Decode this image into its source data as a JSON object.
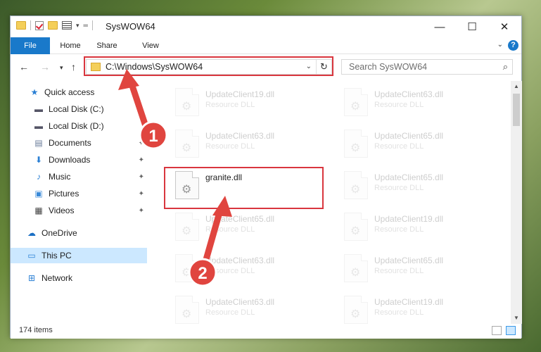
{
  "window": {
    "title": "SysWOW64",
    "controls": {
      "minimize": "—",
      "maximize": "☐",
      "close": "✕"
    }
  },
  "ribbon": {
    "tabs": [
      "File",
      "Home",
      "Share",
      "View"
    ],
    "help": "?"
  },
  "navigation": {
    "address": "C:\\Windows\\SysWOW64",
    "search_placeholder": "Search SysWOW64"
  },
  "sidebar": {
    "items": [
      {
        "label": "Quick access",
        "icon": "star-icon"
      },
      {
        "label": "Local Disk (C:)",
        "icon": "drive-icon",
        "pinned": true
      },
      {
        "label": "Local Disk (D:)",
        "icon": "drive-icon",
        "pinned": true
      },
      {
        "label": "Documents",
        "icon": "documents-icon",
        "pinned": true
      },
      {
        "label": "Downloads",
        "icon": "download-icon",
        "pinned": true
      },
      {
        "label": "Music",
        "icon": "music-icon",
        "pinned": true
      },
      {
        "label": "Pictures",
        "icon": "pictures-icon",
        "pinned": true
      },
      {
        "label": "Videos",
        "icon": "videos-icon",
        "pinned": true
      },
      {
        "label": "OneDrive",
        "icon": "cloud-icon"
      },
      {
        "label": "This PC",
        "icon": "computer-icon",
        "selected": true
      },
      {
        "label": "Network",
        "icon": "network-icon"
      }
    ]
  },
  "files": {
    "type_label": "Resource DLL",
    "items": [
      {
        "name": "UpdateClient19.dll",
        "type": "Resource DLL",
        "faded": true
      },
      {
        "name": "UpdateClient63.dll",
        "type": "Resource DLL",
        "faded": true
      },
      {
        "name": "UpdateClient63.dll",
        "type": "Resource DLL",
        "faded": true
      },
      {
        "name": "UpdateClient65.dll",
        "type": "Resource DLL",
        "faded": true
      },
      {
        "name": "granite.dll",
        "type": "",
        "faded": false,
        "highlighted": true
      },
      {
        "name": "UpdateClient65.dll",
        "type": "Resource DLL",
        "faded": true
      },
      {
        "name": "UpdateClient65.dll",
        "type": "Resource DLL",
        "faded": true
      },
      {
        "name": "UpdateClient19.dll",
        "type": "Resource DLL",
        "faded": true
      },
      {
        "name": "UpdateClient63.dll",
        "type": "Resource DLL",
        "faded": true
      },
      {
        "name": "UpdateClient65.dll",
        "type": "Resource DLL",
        "faded": true
      },
      {
        "name": "UpdateClient63.dll",
        "type": "Resource DLL",
        "faded": true
      },
      {
        "name": "UpdateClient19.dll",
        "type": "Resource DLL",
        "faded": true
      }
    ]
  },
  "status": {
    "item_count": "174 items"
  },
  "annotations": {
    "step1": "1",
    "step2": "2"
  },
  "colors": {
    "accent": "#1979ca",
    "highlight_box": "#d9363e",
    "arrow": "#e0453f",
    "selected_nav": "#cce8ff"
  }
}
